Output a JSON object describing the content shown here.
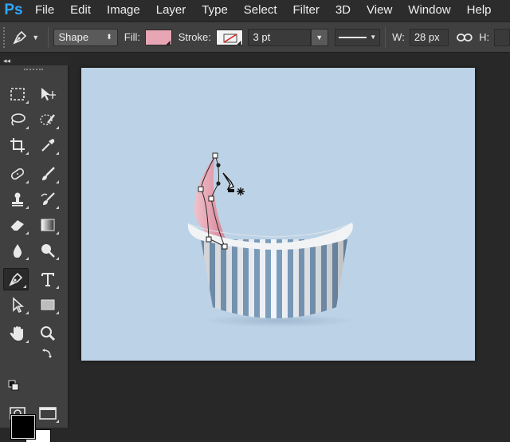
{
  "app": {
    "logo": "Ps"
  },
  "menu": {
    "items": [
      "File",
      "Edit",
      "Image",
      "Layer",
      "Type",
      "Select",
      "Filter",
      "3D",
      "View",
      "Window",
      "Help"
    ]
  },
  "options": {
    "tool_icon": "pen-icon",
    "mode": "Shape",
    "fill_label": "Fill:",
    "fill_color": "#e8a6b4",
    "stroke_label": "Stroke:",
    "stroke_size": "3 pt",
    "width_label": "W:",
    "width_value": "28 px",
    "height_label": "H:"
  },
  "toolbar": {
    "collapse_label": "◂◂",
    "foreground_color": "#000000",
    "background_color": "#ffffff"
  },
  "canvas": {
    "background": "#bcd2e6",
    "accent_pink": "#e8a6b4",
    "stripe_blue": "#7e9fbf"
  }
}
